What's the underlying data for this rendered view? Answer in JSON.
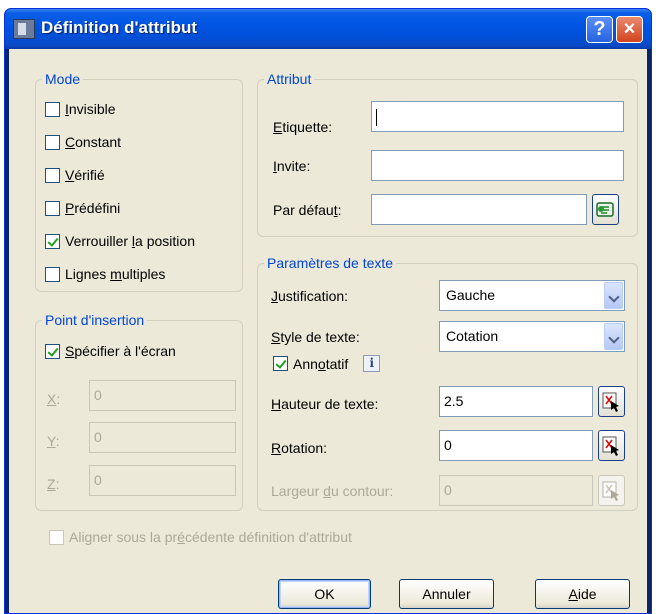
{
  "window": {
    "title": "Définition d'attribut",
    "help_glyph": "?",
    "close_glyph": "×"
  },
  "mode": {
    "legend": "Mode",
    "items": [
      {
        "pre": "",
        "acc": "I",
        "post": "nvisible",
        "checked": false
      },
      {
        "pre": "",
        "acc": "C",
        "post": "onstant",
        "checked": false
      },
      {
        "pre": "",
        "acc": "V",
        "post": "érifié",
        "checked": false
      },
      {
        "pre": "",
        "acc": "P",
        "post": "rédéfini",
        "checked": false
      },
      {
        "pre": "Verrouiller ",
        "acc": "l",
        "post": "a position",
        "checked": true
      },
      {
        "pre": "Lignes ",
        "acc": "m",
        "post": "ultiples",
        "checked": false
      }
    ]
  },
  "attribut": {
    "legend": "Attribut",
    "etiquette": {
      "acc": "E",
      "post": "tiquette:",
      "value": ""
    },
    "invite": {
      "acc": "I",
      "post": "nvite:",
      "value": ""
    },
    "defaut": {
      "pre": "Par défau",
      "acc": "t",
      "post": ":",
      "value": ""
    }
  },
  "insertion": {
    "legend": "Point d'insertion",
    "specifier": {
      "pre": "",
      "acc": "S",
      "post": "pécifier à l'écran",
      "checked": true
    },
    "x": {
      "acc": "X",
      "post": ":",
      "value": "0"
    },
    "y": {
      "acc": "Y",
      "post": ":",
      "value": "0"
    },
    "z": {
      "acc": "Z",
      "post": ":",
      "value": "0"
    }
  },
  "texte": {
    "legend": "Paramètres de texte",
    "justification": {
      "acc": "J",
      "post": "ustification:",
      "value": "Gauche"
    },
    "style": {
      "acc": "S",
      "post": "tyle de texte:",
      "value": "Cotation"
    },
    "annotatif": {
      "pre": "Ann",
      "acc": "o",
      "post": "tatif",
      "checked": true,
      "info": "i"
    },
    "hauteur": {
      "acc": "H",
      "post": "auteur de texte:",
      "value": "2.5"
    },
    "rotation": {
      "acc": "R",
      "post": "otation:",
      "value": "0"
    },
    "largeur": {
      "pre": "Largeur ",
      "acc": "d",
      "post": "u contour:",
      "value": "0"
    }
  },
  "aligner": {
    "pre": "Aligner sous la pr",
    "acc": "é",
    "post": "cédente définition d'attribut",
    "checked": false
  },
  "buttons": {
    "ok": "OK",
    "annuler": "Annuler",
    "aide": {
      "acc": "A",
      "post": "ide"
    }
  }
}
